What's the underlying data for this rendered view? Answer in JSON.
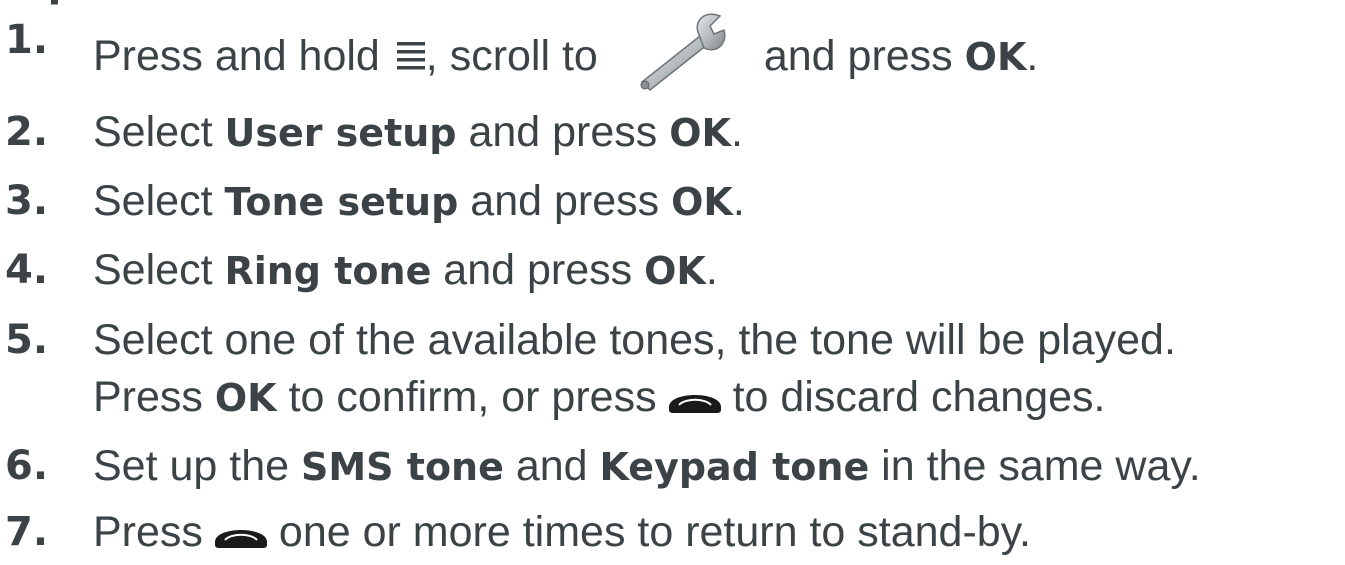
{
  "heading_fragment": "tup",
  "icons": {
    "menu": "menu-lines-icon",
    "settings": "wrench-icon",
    "end_call": "end-call-icon"
  },
  "colors": {
    "text": "#3c4347",
    "icon_dark": "#1a1a1a",
    "wrench_metal": "#b8bdc0"
  },
  "steps": [
    {
      "number": "1.",
      "seg1": "Press and hold ",
      "seg2": ", scroll to",
      "seg3": "and press ",
      "kw1": "OK",
      "end": "."
    },
    {
      "number": "2.",
      "seg1": "Select ",
      "kw1": "User setup",
      "seg2": " and press ",
      "kw2": "OK",
      "end": "."
    },
    {
      "number": "3.",
      "seg1": "Select ",
      "kw1": "Tone setup",
      "seg2": " and press ",
      "kw2": "OK",
      "end": "."
    },
    {
      "number": "4.",
      "seg1": "Select ",
      "kw1": "Ring tone",
      "seg2": " and press ",
      "kw2": "OK",
      "end": "."
    },
    {
      "number": "5.",
      "line1": "Select one of the available tones, the tone will be played.",
      "seg1": "Press ",
      "kw1": "OK",
      "seg2": " to confirm, or press",
      "seg3": "to discard changes."
    },
    {
      "number": "6.",
      "seg1": "Set up the ",
      "kw1": "SMS tone",
      "seg2": " and ",
      "kw2": "Keypad tone",
      "seg3": " in the same way."
    },
    {
      "number": "7.",
      "seg1": "Press",
      "seg2": "one or more times to return to stand-by."
    }
  ]
}
